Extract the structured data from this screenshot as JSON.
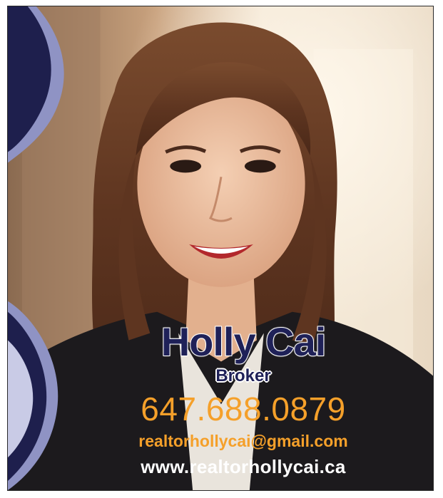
{
  "card": {
    "name": "Holly Cai",
    "title": "Broker",
    "phone": "647.688.0879",
    "email": "realtorhollycai@gmail.com",
    "website": "www.realtorhollycai.ca"
  },
  "colors": {
    "name": "#1f2158",
    "accent": "#f5a02a",
    "swoosh_dark": "#1e1f4d",
    "swoosh_light": "#8f93c4",
    "web": "#ffffff"
  },
  "icons": {
    "decoration": "curved-swoosh"
  }
}
